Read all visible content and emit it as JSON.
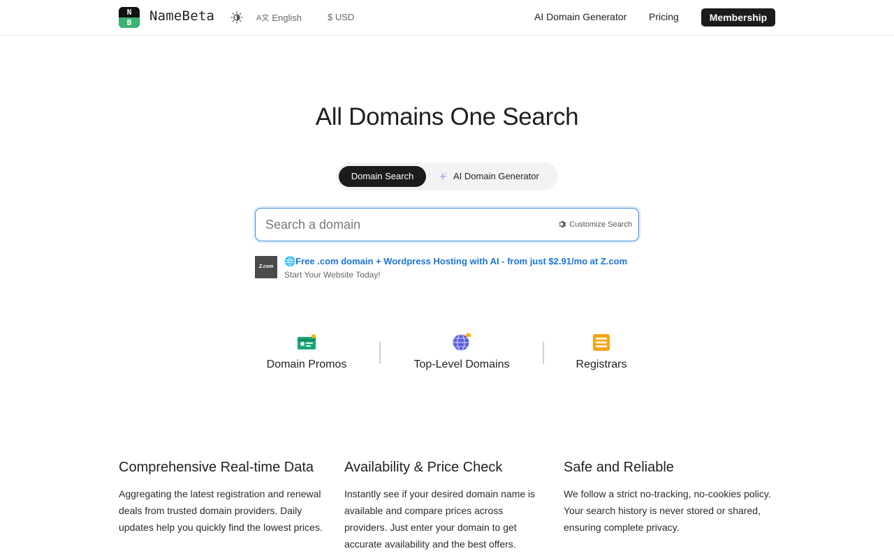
{
  "header": {
    "brand": "NameBeta",
    "logo_top": "N",
    "logo_bottom": "B",
    "language": "English",
    "language_glyph": "A文",
    "currency": "$ USD",
    "nav": {
      "ai_generator": "AI Domain Generator",
      "pricing": "Pricing",
      "membership": "Membership"
    }
  },
  "hero": {
    "title": "All Domains One Search",
    "tabs": {
      "domain_search": "Domain Search",
      "ai_generator": "AI Domain Generator"
    },
    "search": {
      "placeholder": "Search a domain",
      "value": "",
      "customize_label": "Customize Search"
    },
    "ad": {
      "logo_text": "Z.com",
      "title": "🌐Free .com domain + Wordpress Hosting with AI - from just $2.91/mo at Z.com",
      "subtitle": "Start Your Website Today!"
    }
  },
  "quick_links": [
    {
      "label": "Domain Promos",
      "icon": "promo-card-icon"
    },
    {
      "label": "Top-Level Domains",
      "icon": "globe-icon"
    },
    {
      "label": "Registrars",
      "icon": "list-icon"
    }
  ],
  "features": [
    {
      "title": "Comprehensive Real-time Data",
      "text": "Aggregating the latest registration and renewal deals from trusted domain providers. Daily updates help you quickly find the lowest prices."
    },
    {
      "title": "Availability & Price Check",
      "text": "Instantly see if your desired domain name is available and compare prices across providers. Just enter your domain to get accurate availability and the best offers."
    },
    {
      "title": "Safe and Reliable",
      "text": "We follow a strict no-tracking, no-cookies policy. Your search history is never stored or shared, ensuring complete privacy."
    }
  ],
  "colors": {
    "accent_blue": "#1a73d9",
    "dark_button": "#1c1c1c",
    "logo_green": "#3cb371"
  }
}
